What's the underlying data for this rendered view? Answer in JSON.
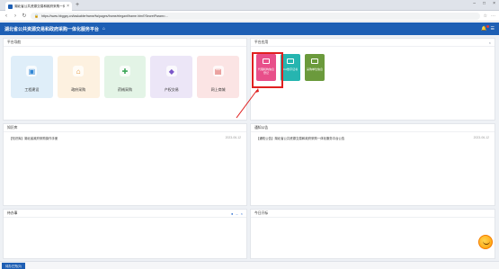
{
  "browser": {
    "tab_title": "湖北省公共资源交易和政府采购一体化服务平台",
    "tab_close": "×",
    "new_tab": "+",
    "window_controls": [
      "–",
      "□",
      "×"
    ],
    "url": "https://www.hbggzy.cn/taskablerframe/fw/pages/frame/elegant/frame.html?SecretParam=..."
  },
  "header": {
    "title": "湖北省公共资源交易和政府采购一体化服务平台"
  },
  "panels": {
    "platform_nav": {
      "title": "平台导航",
      "cards": [
        {
          "label": "工程建设",
          "color": "#dfeef9",
          "icon_color": "#2f86d6",
          "icon": "building-icon"
        },
        {
          "label": "政府采购",
          "color": "#fdf1e0",
          "icon_color": "#e08a2c",
          "icon": "basket-icon"
        },
        {
          "label": "药械采购",
          "color": "#e3f4e6",
          "icon_color": "#3aa657",
          "icon": "medicine-icon"
        },
        {
          "label": "产权交易",
          "color": "#ece6f7",
          "icon_color": "#7b57c9",
          "icon": "property-icon"
        },
        {
          "label": "网上商城",
          "color": "#fbe4e4",
          "icon_color": "#d9534f",
          "icon": "shop-icon"
        }
      ]
    },
    "platform_apps": {
      "title": "平台应用",
      "apps": [
        {
          "label": "代理机构信息登记",
          "color": "#e84f8a"
        },
        {
          "label": "CA数字证书",
          "color": "#26b5b0"
        },
        {
          "label": "采购单位信息",
          "color": "#6b9a3c"
        }
      ]
    },
    "notices_left": {
      "title": "知识库",
      "items": [
        {
          "text": "【知识库】湖北省政府采购操作手册",
          "date": "2023-06-12"
        }
      ]
    },
    "notices_right": {
      "title": "通知公告",
      "items": [
        {
          "text": "【通知公告】湖北省公共资源交易和政府采购一体化服务平台公告",
          "date": "2023-06-12"
        }
      ]
    },
    "todo": {
      "title": "待办事",
      "tools": [
        "●",
        "–",
        "×"
      ]
    },
    "recent": {
      "title": "今日开标"
    }
  },
  "taskbar": {
    "button": "待办已完(0)"
  },
  "colors": {
    "brand": "#1e5fb4",
    "highlight": "#e02020"
  }
}
